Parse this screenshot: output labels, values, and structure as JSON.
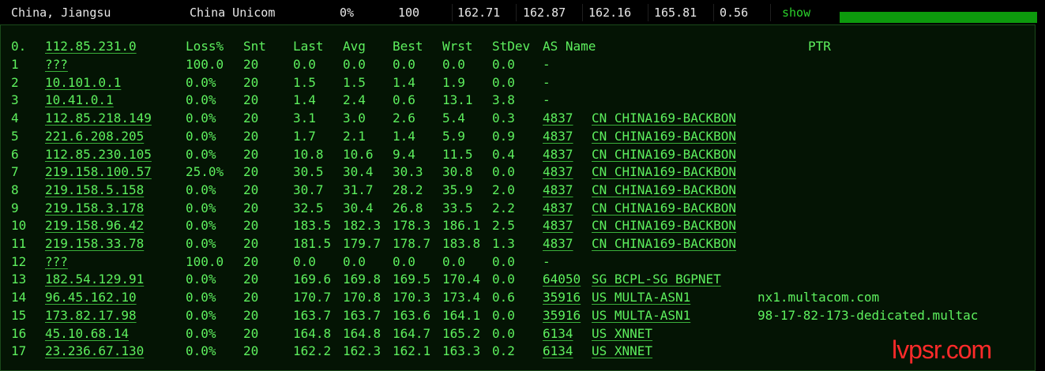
{
  "summary": {
    "location": "China, Jiangsu",
    "isp": "China Unicom",
    "loss": "0%",
    "sent": "100",
    "last": "162.71",
    "avg": "162.87",
    "best": "162.16",
    "worst": "165.81",
    "stdev": "0.56",
    "show_label": "show",
    "bar_fill": 1.0
  },
  "table": {
    "headers": {
      "host": "0.",
      "host_ip": "112.85.231.0",
      "loss": "Loss%",
      "snt": "Snt",
      "last": "Last",
      "avg": "Avg",
      "best": "Best",
      "wrst": "Wrst",
      "stdev": "StDev",
      "as": "AS Name",
      "ptr": "PTR"
    },
    "rows": [
      {
        "n": "1",
        "ip": "???",
        "loss": "100.0",
        "snt": "20",
        "last": "0.0",
        "avg": "0.0",
        "best": "0.0",
        "wrst": "0.0",
        "stdev": "0.0",
        "asn": "-",
        "asname": "",
        "ptr": ""
      },
      {
        "n": "2",
        "ip": "10.101.0.1",
        "loss": "0.0%",
        "snt": "20",
        "last": "1.5",
        "avg": "1.5",
        "best": "1.4",
        "wrst": "1.9",
        "stdev": "0.0",
        "asn": "-",
        "asname": "",
        "ptr": ""
      },
      {
        "n": "3",
        "ip": "10.41.0.1",
        "loss": "0.0%",
        "snt": "20",
        "last": "1.4",
        "avg": "2.4",
        "best": "0.6",
        "wrst": "13.1",
        "stdev": "3.8",
        "asn": "-",
        "asname": "",
        "ptr": ""
      },
      {
        "n": "4",
        "ip": "112.85.218.149",
        "loss": "0.0%",
        "snt": "20",
        "last": "3.1",
        "avg": "3.0",
        "best": "2.6",
        "wrst": "5.4",
        "stdev": "0.3",
        "asn": "4837",
        "asname": "CN CHINA169-BACKBON",
        "ptr": ""
      },
      {
        "n": "5",
        "ip": "221.6.208.205",
        "loss": "0.0%",
        "snt": "20",
        "last": "1.7",
        "avg": "2.1",
        "best": "1.4",
        "wrst": "5.9",
        "stdev": "0.9",
        "asn": "4837",
        "asname": "CN CHINA169-BACKBON",
        "ptr": ""
      },
      {
        "n": "6",
        "ip": "112.85.230.105",
        "loss": "0.0%",
        "snt": "20",
        "last": "10.8",
        "avg": "10.6",
        "best": "9.4",
        "wrst": "11.5",
        "stdev": "0.4",
        "asn": "4837",
        "asname": "CN CHINA169-BACKBON",
        "ptr": ""
      },
      {
        "n": "7",
        "ip": "219.158.100.57",
        "loss": "25.0%",
        "snt": "20",
        "last": "30.5",
        "avg": "30.4",
        "best": "30.3",
        "wrst": "30.8",
        "stdev": "0.0",
        "asn": "4837",
        "asname": "CN CHINA169-BACKBON",
        "ptr": ""
      },
      {
        "n": "8",
        "ip": "219.158.5.158",
        "loss": "0.0%",
        "snt": "20",
        "last": "30.7",
        "avg": "31.7",
        "best": "28.2",
        "wrst": "35.9",
        "stdev": "2.0",
        "asn": "4837",
        "asname": "CN CHINA169-BACKBON",
        "ptr": ""
      },
      {
        "n": "9",
        "ip": "219.158.3.178",
        "loss": "0.0%",
        "snt": "20",
        "last": "32.5",
        "avg": "30.4",
        "best": "26.8",
        "wrst": "33.5",
        "stdev": "2.2",
        "asn": "4837",
        "asname": "CN CHINA169-BACKBON",
        "ptr": ""
      },
      {
        "n": "10",
        "ip": "219.158.96.42",
        "loss": "0.0%",
        "snt": "20",
        "last": "183.5",
        "avg": "182.3",
        "best": "178.3",
        "wrst": "186.1",
        "stdev": "2.5",
        "asn": "4837",
        "asname": "CN CHINA169-BACKBON",
        "ptr": ""
      },
      {
        "n": "11",
        "ip": "219.158.33.78",
        "loss": "0.0%",
        "snt": "20",
        "last": "181.5",
        "avg": "179.7",
        "best": "178.7",
        "wrst": "183.8",
        "stdev": "1.3",
        "asn": "4837",
        "asname": "CN CHINA169-BACKBON",
        "ptr": ""
      },
      {
        "n": "12",
        "ip": "???",
        "loss": "100.0",
        "snt": "20",
        "last": "0.0",
        "avg": "0.0",
        "best": "0.0",
        "wrst": "0.0",
        "stdev": "0.0",
        "asn": "-",
        "asname": "",
        "ptr": ""
      },
      {
        "n": "13",
        "ip": "182.54.129.91",
        "loss": "0.0%",
        "snt": "20",
        "last": "169.6",
        "avg": "169.8",
        "best": "169.5",
        "wrst": "170.4",
        "stdev": "0.0",
        "asn": "64050",
        "asname": "SG BCPL-SG BGPNET",
        "ptr": ""
      },
      {
        "n": "14",
        "ip": "96.45.162.10",
        "loss": "0.0%",
        "snt": "20",
        "last": "170.7",
        "avg": "170.8",
        "best": "170.3",
        "wrst": "173.4",
        "stdev": "0.6",
        "asn": "35916",
        "asname": "US MULTA-ASN1",
        "ptr": "nx1.multacom.com"
      },
      {
        "n": "15",
        "ip": "173.82.17.98",
        "loss": "0.0%",
        "snt": "20",
        "last": "163.7",
        "avg": "163.7",
        "best": "163.6",
        "wrst": "164.1",
        "stdev": "0.0",
        "asn": "35916",
        "asname": "US MULTA-ASN1",
        "ptr": "98-17-82-173-dedicated.multac"
      },
      {
        "n": "16",
        "ip": "45.10.68.14",
        "loss": "0.0%",
        "snt": "20",
        "last": "164.8",
        "avg": "164.8",
        "best": "164.7",
        "wrst": "165.2",
        "stdev": "0.0",
        "asn": "6134",
        "asname": "US XNNET",
        "ptr": ""
      },
      {
        "n": "17",
        "ip": "23.236.67.130",
        "loss": "0.0%",
        "snt": "20",
        "last": "162.2",
        "avg": "162.3",
        "best": "162.1",
        "wrst": "163.3",
        "stdev": "0.2",
        "asn": "6134",
        "asname": "US XNNET",
        "ptr": ""
      }
    ]
  },
  "watermark": "lvpsr.com",
  "colors": {
    "terminal_text": "#5ef05e",
    "terminal_bg": "#041404",
    "bar": "#0d9a0d",
    "watermark": "#ff2a2a"
  }
}
